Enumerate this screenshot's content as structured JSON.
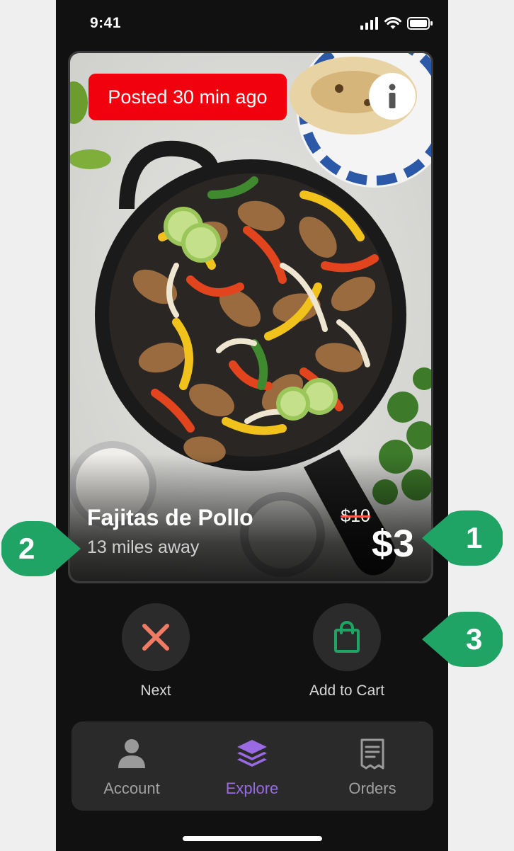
{
  "status_bar": {
    "time": "9:41",
    "icons": [
      "cellular-signal-icon",
      "wifi-icon",
      "battery-icon"
    ]
  },
  "listing": {
    "posted_badge": "Posted 30 min ago",
    "title": "Fajitas de Pollo",
    "distance": "13 miles away",
    "original_price": "$10",
    "price": "$3",
    "image": "skillet-chicken-fajitas-photo"
  },
  "actions": {
    "next_label": "Next",
    "add_to_cart_label": "Add to Cart"
  },
  "tabs": [
    {
      "label": "Account",
      "icon": "person-icon",
      "active": false
    },
    {
      "label": "Explore",
      "icon": "layers-icon",
      "active": true
    },
    {
      "label": "Orders",
      "icon": "receipt-icon",
      "active": false
    }
  ],
  "callouts": [
    "1",
    "2",
    "3"
  ],
  "colors": {
    "badge_red": "#f1000d",
    "active_tab": "#9a6ae2",
    "next_x": "#f07b64",
    "cart_green": "#1fa466",
    "callout_green": "#1fa466"
  }
}
